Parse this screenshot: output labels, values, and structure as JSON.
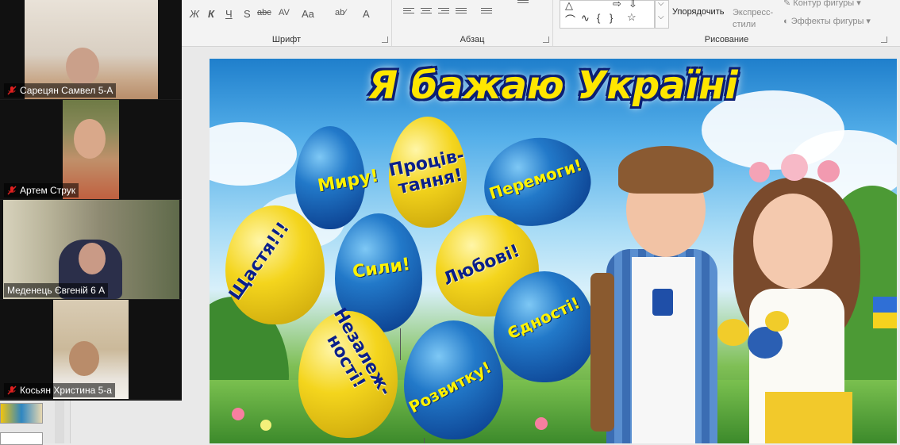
{
  "ribbon": {
    "font": {
      "group_label": "Шрифт",
      "bold": "Ж",
      "italic": "К",
      "underline": "Ч",
      "shadow": "S",
      "strike": "abc",
      "spacing": "AV",
      "case": "Aa",
      "color": "A"
    },
    "paragraph": {
      "group_label": "Абзац"
    },
    "drawing": {
      "group_label": "Рисование",
      "arrange": "Упорядочить",
      "quick_styles": "Экспресс-\nстили",
      "shape_outline": "Контур фигуры",
      "shape_effects": "Эффекты фигуры"
    }
  },
  "participants": [
    {
      "name": "Сарецян Самвел 5-А"
    },
    {
      "name": "Артем Струк"
    },
    {
      "name": "Меденець Євгеній 6 А"
    },
    {
      "name": "Косьян Христина 5-а"
    }
  ],
  "slide": {
    "title": "Я бажаю Україні",
    "balloons": [
      {
        "text": "Миру!",
        "color": "blue"
      },
      {
        "text": "Проців-\nтання!",
        "color": "yellow"
      },
      {
        "text": "Перемоги!",
        "color": "blue"
      },
      {
        "text": "Щастя!!!",
        "color": "yellow"
      },
      {
        "text": "Сили!",
        "color": "blue"
      },
      {
        "text": "Любові!",
        "color": "yellow"
      },
      {
        "text": "Єдності!",
        "color": "blue"
      },
      {
        "text": "Незалеж-\nності!",
        "color": "yellow"
      },
      {
        "text": "Розвитку!",
        "color": "blue"
      }
    ]
  },
  "colors": {
    "title_fill": "#ffe600",
    "title_outline": "#0b1e73",
    "balloon_blue": "#2279c9",
    "balloon_yellow": "#f4d51d"
  }
}
